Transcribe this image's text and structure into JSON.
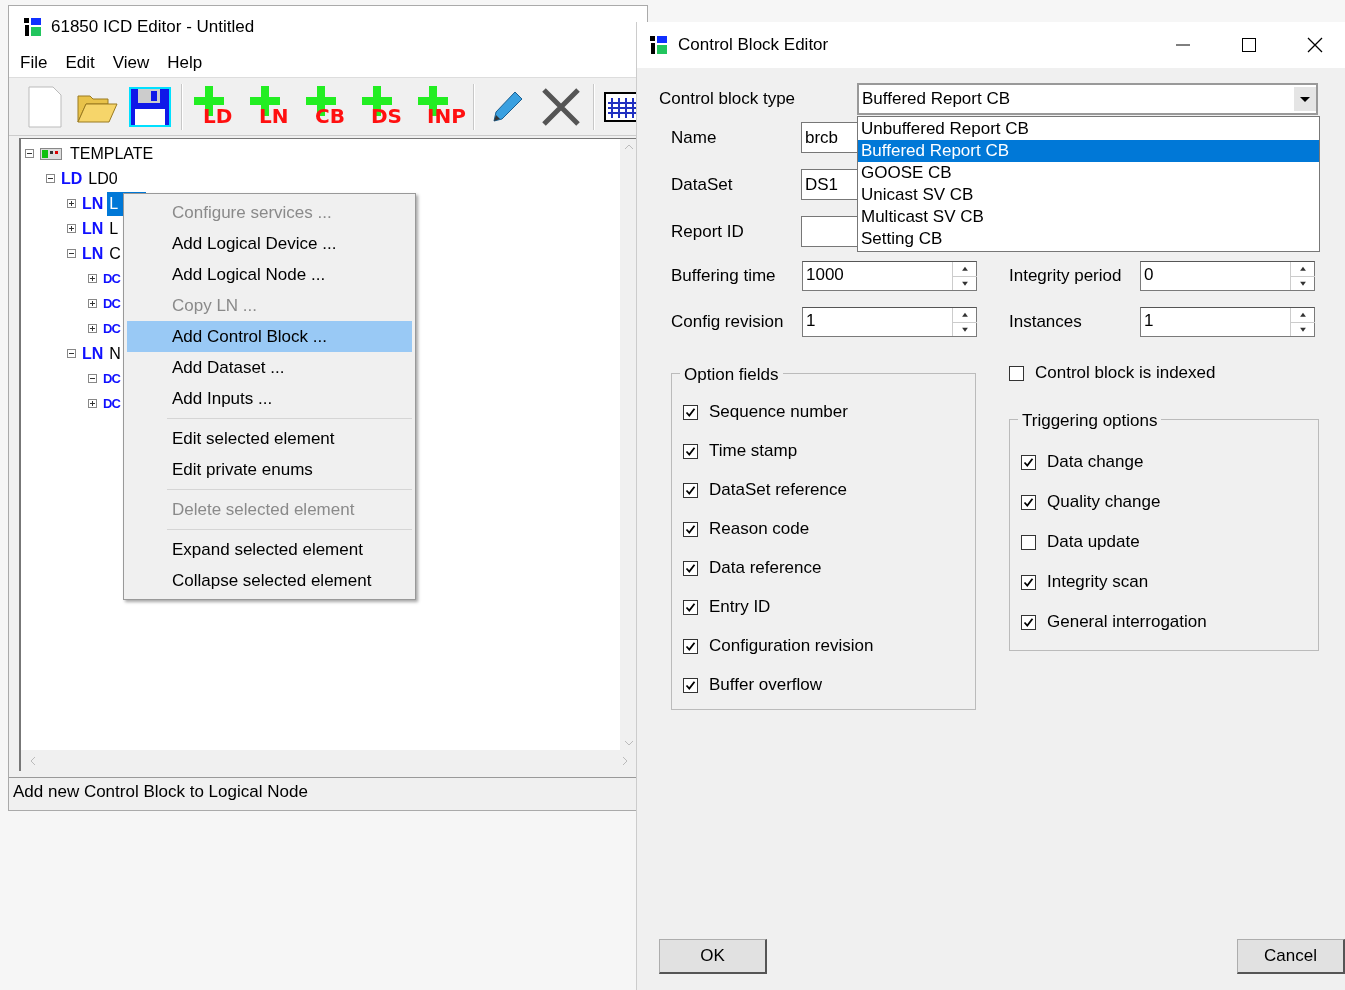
{
  "editor_window": {
    "title": "61850 ICD Editor - Untitled",
    "menu": [
      "File",
      "Edit",
      "View",
      "Help"
    ],
    "toolbar": [
      {
        "kind": "new"
      },
      {
        "kind": "open"
      },
      {
        "kind": "save"
      },
      {
        "kind": "separator"
      },
      {
        "kind": "add",
        "label": "LD"
      },
      {
        "kind": "add",
        "label": "LN"
      },
      {
        "kind": "add",
        "label": "CB"
      },
      {
        "kind": "add",
        "label": "DS"
      },
      {
        "kind": "add",
        "label": "INP"
      },
      {
        "kind": "separator"
      },
      {
        "kind": "edit"
      },
      {
        "kind": "delete"
      },
      {
        "kind": "separator"
      },
      {
        "kind": "grid"
      }
    ],
    "tree": [
      {
        "name": "TEMPLATE",
        "expanded": true,
        "selected": false,
        "children": [
          {
            "tag": "LD",
            "name": "LD0",
            "expanded": true,
            "selected": false,
            "children": [
              {
                "tag": "LN",
                "name": "L",
                "expanded": false,
                "selected": true
              },
              {
                "tag": "LN",
                "name": "L",
                "expanded": false,
                "selected": false
              },
              {
                "tag": "LN",
                "name": "C",
                "expanded": true,
                "selected": false,
                "children": [
                  {
                    "tag": "DC",
                    "expanded": false
                  },
                  {
                    "tag": "DC",
                    "expanded": false
                  },
                  {
                    "tag": "DC",
                    "expanded": false
                  }
                ]
              },
              {
                "tag": "LN",
                "name": "N",
                "expanded": true,
                "selected": false,
                "children": [
                  {
                    "tag": "DC",
                    "expanded": true
                  },
                  {
                    "tag": "DC",
                    "expanded": false
                  }
                ]
              }
            ]
          }
        ]
      }
    ],
    "status_bar": "Add new Control Block to Logical Node"
  },
  "context_menu": [
    {
      "kind": "item",
      "label": "Configure services ...",
      "disabled": true,
      "selected": false
    },
    {
      "kind": "item",
      "label": "Add Logical Device ...",
      "disabled": false,
      "selected": false
    },
    {
      "kind": "item",
      "label": "Add Logical Node ...",
      "disabled": false,
      "selected": false
    },
    {
      "kind": "item",
      "label": "Copy LN ...",
      "disabled": true,
      "selected": false
    },
    {
      "kind": "item",
      "label": "Add Control Block ...",
      "disabled": false,
      "selected": true
    },
    {
      "kind": "item",
      "label": "Add Dataset ...",
      "disabled": false,
      "selected": false
    },
    {
      "kind": "item",
      "label": "Add Inputs ...",
      "disabled": false,
      "selected": false
    },
    {
      "kind": "separator"
    },
    {
      "kind": "item",
      "label": "Edit selected element",
      "disabled": false,
      "selected": false
    },
    {
      "kind": "item",
      "label": "Edit private enums",
      "disabled": false,
      "selected": false
    },
    {
      "kind": "separator"
    },
    {
      "kind": "item",
      "label": "Delete selected element",
      "disabled": true,
      "selected": false
    },
    {
      "kind": "separator"
    },
    {
      "kind": "item",
      "label": "Expand selected element",
      "disabled": false,
      "selected": false
    },
    {
      "kind": "item",
      "label": "Collapse selected element",
      "disabled": false,
      "selected": false
    }
  ],
  "dialog": {
    "title": "Control Block Editor",
    "type_label": "Control block type",
    "type_value": "Buffered Report CB",
    "type_options": [
      {
        "label": "Unbuffered Report CB",
        "selected": false
      },
      {
        "label": "Buffered Report CB",
        "selected": true
      },
      {
        "label": "GOOSE CB",
        "selected": false
      },
      {
        "label": "Unicast SV CB",
        "selected": false
      },
      {
        "label": "Multicast SV CB",
        "selected": false
      },
      {
        "label": "Setting CB",
        "selected": false
      }
    ],
    "text_fields": [
      {
        "label": "Name",
        "value": "brcb"
      },
      {
        "label": "DataSet",
        "value": "DS1"
      },
      {
        "label": "Report ID"
      }
    ],
    "spin_rows": [
      [
        {
          "label": "Buffering time",
          "value": "1000"
        },
        {
          "label": "Integrity period",
          "value": "0"
        }
      ],
      [
        {
          "label": "Config revision",
          "value": "1"
        },
        {
          "label": "Instances",
          "value": "1"
        }
      ]
    ],
    "option_fields": {
      "title": "Option fields",
      "items": [
        {
          "label": "Sequence number",
          "checked": true
        },
        {
          "label": "Time stamp",
          "checked": true
        },
        {
          "label": "DataSet reference",
          "checked": true
        },
        {
          "label": "Reason code",
          "checked": true
        },
        {
          "label": "Data reference",
          "checked": true
        },
        {
          "label": "Entry ID",
          "checked": true
        },
        {
          "label": "Configuration revision",
          "checked": true
        },
        {
          "label": "Buffer overflow",
          "checked": true
        }
      ]
    },
    "indexed": {
      "label": "Control block is indexed",
      "checked": false
    },
    "triggering": {
      "title": "Triggering options",
      "items": [
        {
          "label": "Data change",
          "checked": true
        },
        {
          "label": "Quality change",
          "checked": true
        },
        {
          "label": "Data update",
          "checked": false
        },
        {
          "label": "Integrity scan",
          "checked": true
        },
        {
          "label": "General interrogation",
          "checked": true
        }
      ]
    },
    "buttons": [
      "OK",
      "Cancel"
    ]
  }
}
